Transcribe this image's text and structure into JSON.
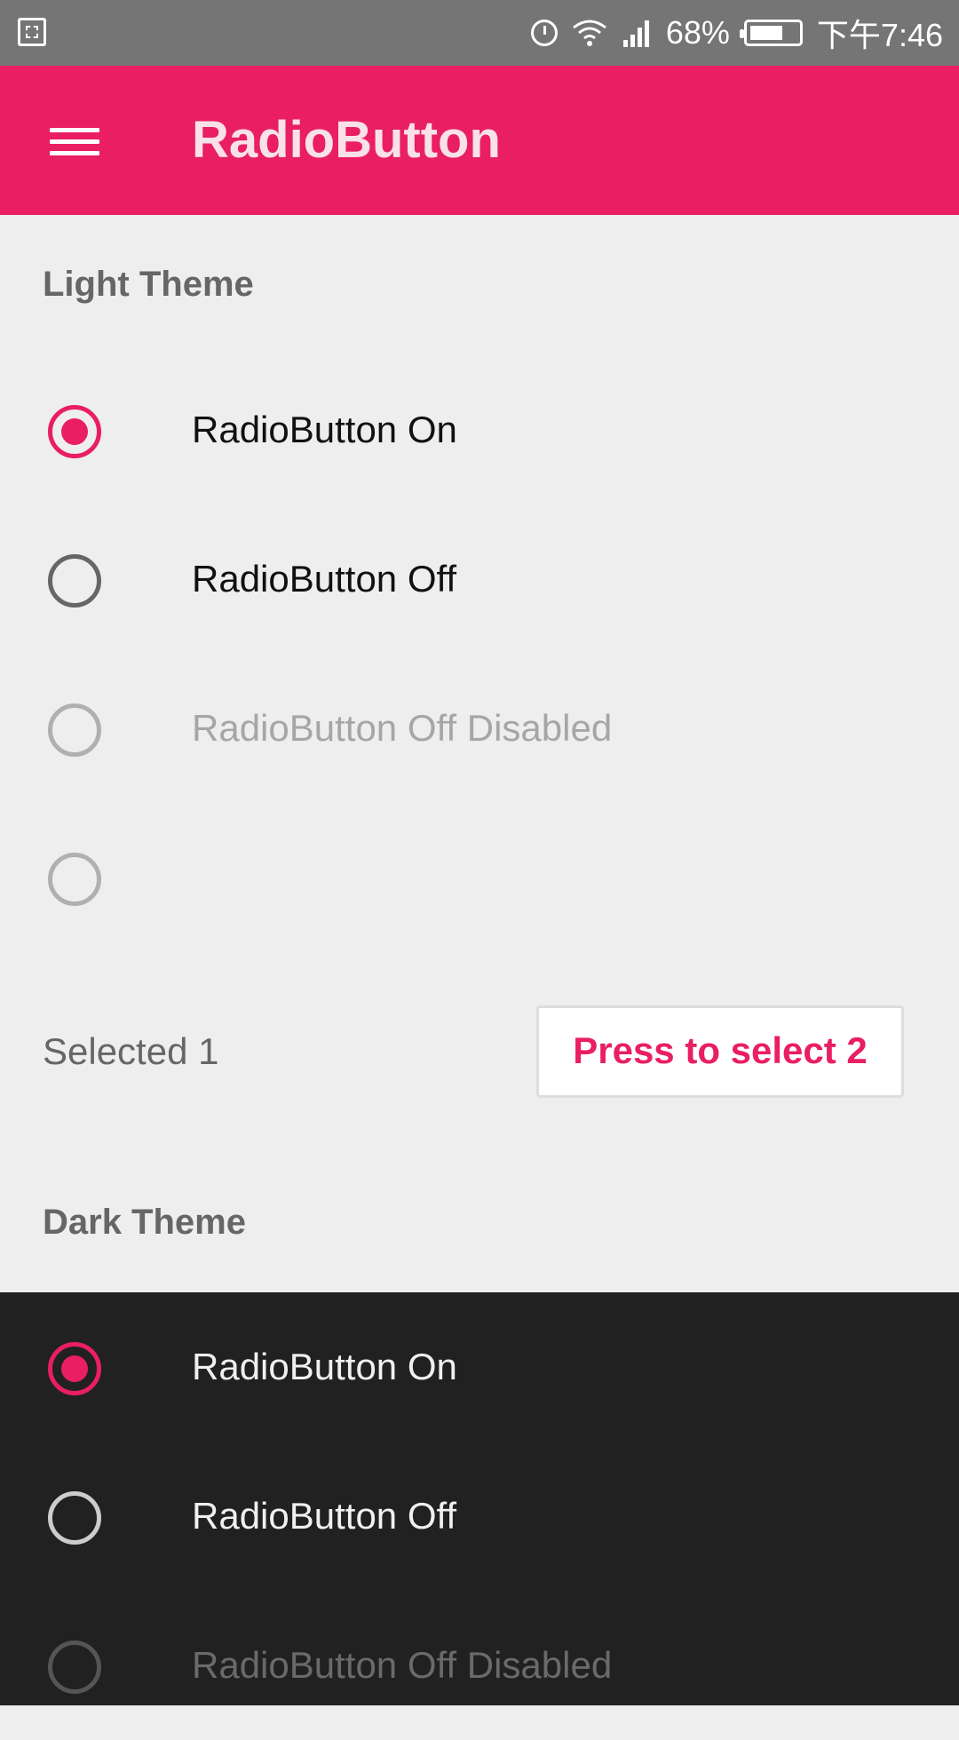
{
  "status_bar": {
    "battery_percent": "68%",
    "time": "下午7:46",
    "icons": [
      "screenshot-icon",
      "alarm-icon",
      "wifi-icon",
      "signal-icon",
      "battery-icon"
    ]
  },
  "app_bar": {
    "title": "RadioButton",
    "color": "#e91e63",
    "menu_icon": "menu-icon"
  },
  "light_theme": {
    "title": "Light Theme",
    "radios": [
      {
        "label": "RadioButton On",
        "checked": true,
        "enabled": true
      },
      {
        "label": "RadioButton Off",
        "checked": false,
        "enabled": true
      },
      {
        "label": "RadioButton Off Disabled",
        "checked": false,
        "enabled": false
      },
      {
        "label": "",
        "checked": false,
        "enabled": false
      }
    ],
    "selected_text": "Selected 1",
    "button_label": "Press to select 2"
  },
  "dark_theme": {
    "title": "Dark Theme",
    "radios": [
      {
        "label": "RadioButton On",
        "checked": true,
        "enabled": true
      },
      {
        "label": "RadioButton Off",
        "checked": false,
        "enabled": true
      },
      {
        "label": "RadioButton Off Disabled",
        "checked": false,
        "enabled": false
      }
    ]
  }
}
